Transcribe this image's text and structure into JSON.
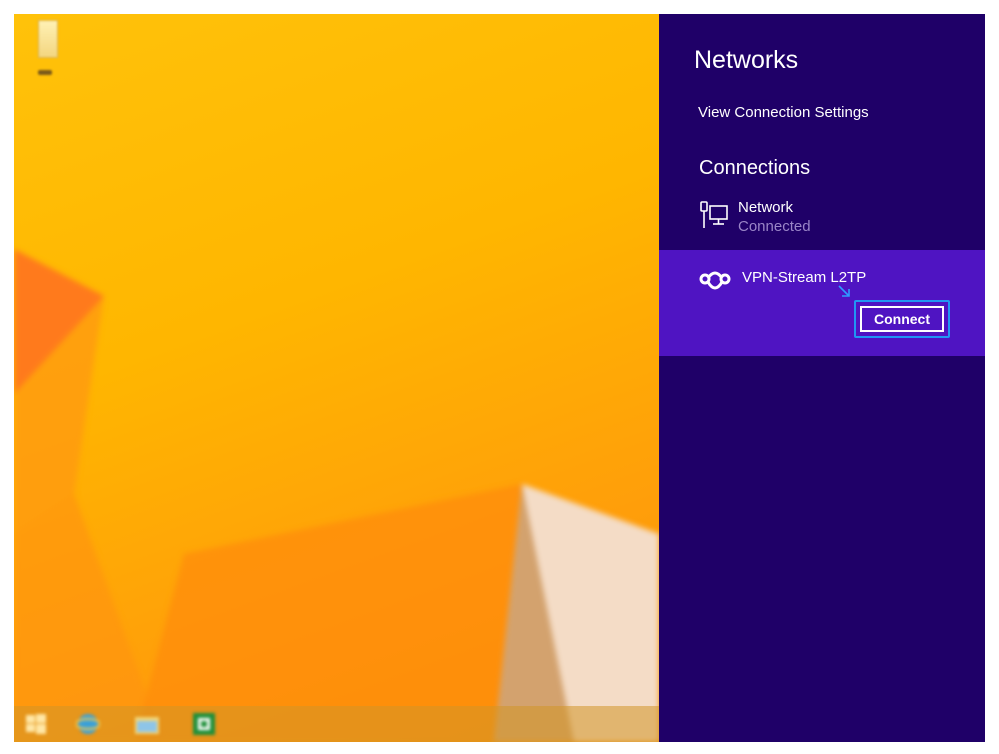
{
  "panel": {
    "title": "Networks",
    "settings_link": "View Connection Settings",
    "section_title": "Connections",
    "items": [
      {
        "name": "Network",
        "status": "Connected",
        "icon": "wired-network-icon"
      },
      {
        "name": "VPN-Stream L2TP",
        "icon": "vpn-icon",
        "action_label": "Connect",
        "selected": true
      }
    ]
  },
  "taskbar": {
    "icons": [
      "windows-start-icon",
      "internet-explorer-icon",
      "file-explorer-icon",
      "excel-icon"
    ]
  },
  "colors": {
    "panel_bg": "#1f0068",
    "selected_item_bg": "#4f14c2",
    "focus_border": "#2196f3",
    "desktop_bg": "#ffb600"
  }
}
